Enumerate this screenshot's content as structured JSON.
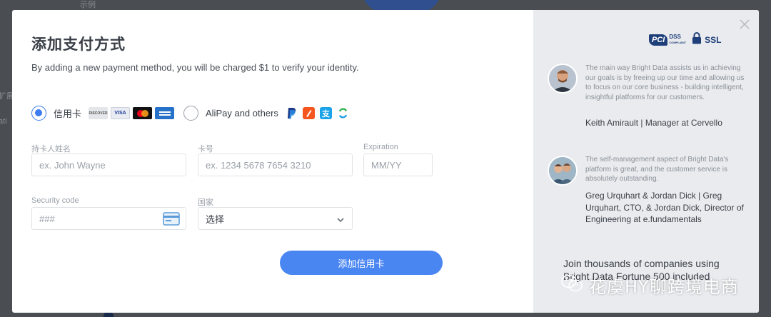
{
  "modal": {
    "title": "添加支付方式",
    "subtitle": "By adding a new payment method, you will be charged $1 to verify your identity."
  },
  "methods": {
    "card": {
      "label": "信用卡",
      "selected": true,
      "logos": [
        "discover-logo",
        "visa-logo",
        "mastercard-logo",
        "amex-logo"
      ],
      "discover_text": "DISCOVER",
      "visa_text": "VISA"
    },
    "alipay": {
      "label": "AliPay and others",
      "selected": false,
      "logos": [
        "paypal-logo",
        "orange-wallet-logo",
        "alipay-logo",
        "wechat-pay-logo"
      ],
      "alipay_glyph": "支"
    }
  },
  "form": {
    "cardholder": {
      "label": "持卡人姓名",
      "placeholder": "ex. John Wayne"
    },
    "card_number": {
      "label": "卡号",
      "placeholder": "ex. 1234 5678 7654 3210"
    },
    "expiration": {
      "label": "Expiration",
      "placeholder": "MM/YY"
    },
    "security_code": {
      "label": "Security code",
      "placeholder": "###"
    },
    "country": {
      "label": "国家",
      "value": "选择"
    }
  },
  "submit_label": "添加信用卡",
  "badges": {
    "pci": "PCI",
    "dss": "DSS",
    "dss_sub": "COMPLIANT",
    "ssl": "SSL"
  },
  "testimonials": [
    {
      "quote": "The main way Bright Data assists us in achieving our goals is by freeing up our time and allowing us to focus on our core business - building intelligent, insightful platforms for our customers.",
      "author": "Keith Amirault | Manager at Cervello"
    },
    {
      "quote": "The self-management aspect of Bright Data's platform is great, and the customer service is absolutely outstanding.",
      "author": "Greg Urquhart & Jordan Dick | Greg Urquhart, CTO, & Jordan Dick, Director of Engineering at e.fundamentals"
    }
  ],
  "join_text": "Join thousands of companies using Bright Data Fortune 500 included",
  "watermark": "花虞HY聊跨境电商",
  "backdrop": {
    "top_text": "示例",
    "left_text_1": "扩展",
    "left_text_2": "ati"
  },
  "colors": {
    "accent": "#4a86f2",
    "brand_navy": "#1e3f7a",
    "panel": "#e9ebee"
  }
}
